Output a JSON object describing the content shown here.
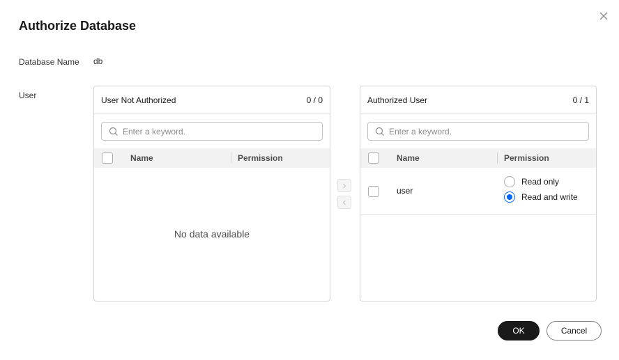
{
  "dialog": {
    "title": "Authorize Database",
    "ok_label": "OK",
    "cancel_label": "Cancel"
  },
  "fields": {
    "database_name_label": "Database Name",
    "database_name_value": "db",
    "user_label": "User"
  },
  "left_panel": {
    "title": "User Not Authorized",
    "count": "0 / 0",
    "search_placeholder": "Enter a keyword.",
    "col_name": "Name",
    "col_permission": "Permission",
    "empty_text": "No data available"
  },
  "right_panel": {
    "title": "Authorized User",
    "count": "0 / 1",
    "search_placeholder": "Enter a keyword.",
    "col_name": "Name",
    "col_permission": "Permission",
    "rows": [
      {
        "name": "user",
        "options": [
          "Read only",
          "Read and write"
        ],
        "selected": "Read and write"
      }
    ]
  },
  "transfer": {
    "right_icon": "chevron-right-icon",
    "left_icon": "chevron-left-icon"
  },
  "colors": {
    "accent": "#0066ff",
    "primary_button": "#191919"
  }
}
